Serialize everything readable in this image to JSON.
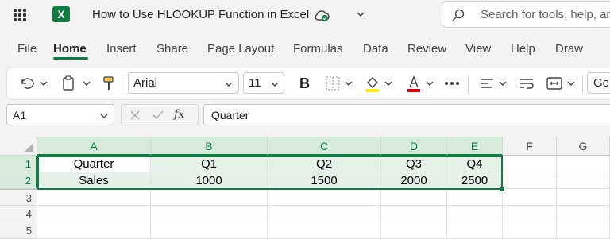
{
  "window": {
    "doc_title": "How to Use HLOOKUP Function in Excel",
    "search_placeholder": "Search for tools, help, an",
    "app_logo": "X"
  },
  "menu": [
    "File",
    "Home",
    "Insert",
    "Share",
    "Page Layout",
    "Formulas",
    "Data",
    "Review",
    "View",
    "Help",
    "Draw"
  ],
  "active_menu": "Home",
  "ribbon": {
    "font": "Arial",
    "size": "11",
    "bold": "B",
    "styles_label": "Ge"
  },
  "formula_bar": {
    "name_box": "A1",
    "fx": "fx",
    "content": "Quarter"
  },
  "sheet": {
    "columns": [
      "A",
      "B",
      "C",
      "D",
      "E",
      "F",
      "G"
    ],
    "rows": [
      "1",
      "2",
      "3",
      "4",
      "5"
    ],
    "cells": [
      [
        "Quarter",
        "Q1",
        "Q2",
        "Q3",
        "Q4"
      ],
      [
        "Sales",
        "1000",
        "1500",
        "2000",
        "2500"
      ]
    ]
  },
  "colors": {
    "accent": "#107c41",
    "selection_fill": "#e6f2e9"
  }
}
